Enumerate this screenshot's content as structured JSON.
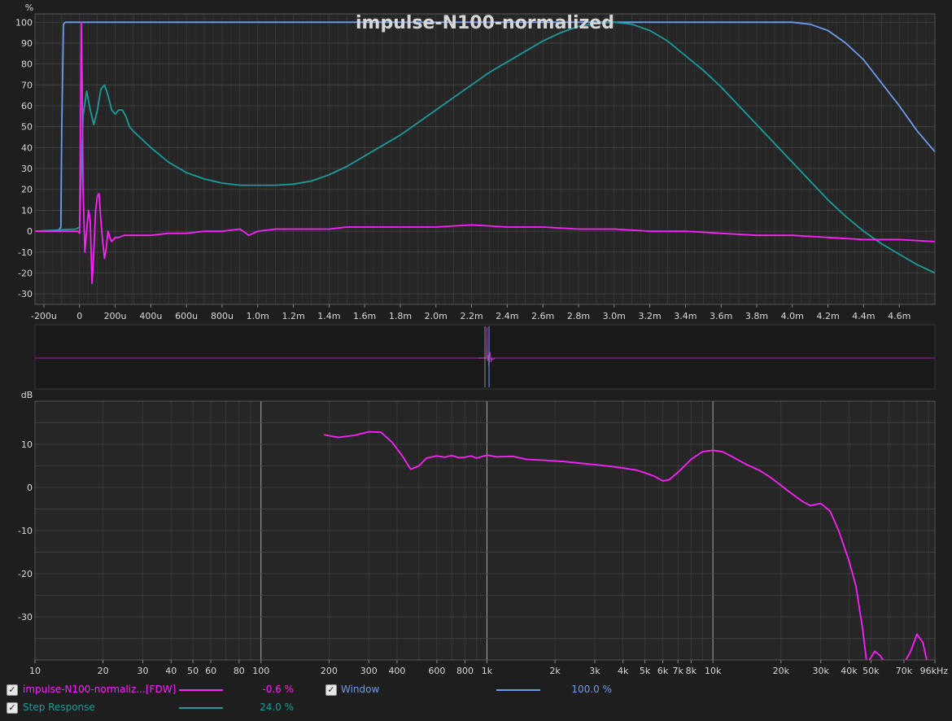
{
  "title": "impulse-N100-normalized",
  "colors": {
    "background": "#1e1e1e",
    "plot_bg": "#262626",
    "grid": "#444444",
    "impulse": "#ff20ff",
    "window": "#6d9bee",
    "step": "#1b9c9c",
    "text": "#d8d8d8"
  },
  "chart_data": [
    {
      "type": "line",
      "panel": "time-domain",
      "ylabel": "%",
      "xlim": [
        -0.00025,
        0.0048
      ],
      "ylim": [
        -35,
        104
      ],
      "x_tick_labels": [
        "-200u",
        "0",
        "200u",
        "400u",
        "600u",
        "800u",
        "1.0m",
        "1.2m",
        "1.4m",
        "1.6m",
        "1.8m",
        "2.0m",
        "2.2m",
        "2.4m",
        "2.6m",
        "2.8m",
        "3.0m",
        "3.2m",
        "3.4m",
        "3.6m",
        "3.8m",
        "4.0m",
        "4.2m",
        "4.4m",
        "4.6m"
      ],
      "y_tick_labels": [
        "100",
        "90",
        "80",
        "70",
        "60",
        "50",
        "40",
        "30",
        "20",
        "10",
        "0",
        "-10",
        "-20",
        "-30"
      ],
      "grid": true,
      "series": [
        {
          "name": "Window",
          "color": "#6d9bee",
          "x": [
            -0.00025,
            -0.00012,
            -0.000105,
            -0.0001,
            -9e-05,
            -8e-05,
            0.0039,
            0.004,
            0.0041,
            0.0042,
            0.0043,
            0.0044,
            0.0045,
            0.0046,
            0.0047,
            0.0048
          ],
          "y": [
            0,
            0,
            2,
            50,
            99,
            100,
            100,
            100,
            99,
            96,
            90,
            82,
            71,
            60,
            48,
            38
          ]
        },
        {
          "name": "Step Response",
          "color": "#1b9c9c",
          "x": [
            -0.00025,
            -2e-05,
            0.0,
            2e-05,
            4e-05,
            6e-05,
            8e-05,
            0.0001,
            0.00012,
            0.00014,
            0.00016,
            0.00018,
            0.0002,
            0.00022,
            0.00024,
            0.00026,
            0.00028,
            0.0003,
            0.0004,
            0.0005,
            0.0006,
            0.0007,
            0.0008,
            0.0009,
            0.001,
            0.0011,
            0.0012,
            0.0013,
            0.0014,
            0.0015,
            0.0016,
            0.0017,
            0.0018,
            0.0019,
            0.002,
            0.0021,
            0.0022,
            0.0023,
            0.0024,
            0.0025,
            0.0026,
            0.0027,
            0.0028,
            0.0029,
            0.003,
            0.0031,
            0.0032,
            0.0033,
            0.0034,
            0.0035,
            0.0036,
            0.0037,
            0.0038,
            0.0039,
            0.004,
            0.0041,
            0.0042,
            0.0043,
            0.0044,
            0.0045,
            0.0046,
            0.0047,
            0.0048
          ],
          "y": [
            0,
            1,
            2,
            55,
            67,
            58,
            51,
            58,
            68,
            70,
            65,
            58,
            56,
            58,
            58,
            55,
            50,
            48,
            40,
            33,
            28,
            25,
            23,
            22,
            22,
            22,
            22.5,
            24,
            27,
            31,
            36,
            41,
            46,
            52,
            58,
            64,
            70,
            76,
            81,
            86,
            91,
            95,
            98,
            99.5,
            100,
            99,
            96,
            91,
            84,
            77,
            69,
            60,
            51,
            42,
            33,
            24,
            15,
            7,
            0,
            -6,
            -11,
            -16,
            -20
          ]
        },
        {
          "name": "impulse-N100-normaliz...[FDW]",
          "color": "#ff20ff",
          "x": [
            -0.00025,
            -1e-05,
            0.0,
            5e-06,
            1e-05,
            1.5e-05,
            2e-05,
            3e-05,
            4e-05,
            5e-05,
            6e-05,
            7e-05,
            8e-05,
            9e-05,
            0.0001,
            0.00011,
            0.00012,
            0.00013,
            0.00014,
            0.00015,
            0.00016,
            0.00017,
            0.00018,
            0.00019,
            0.0002,
            0.00022,
            0.00025,
            0.0003,
            0.0004,
            0.0005,
            0.0006,
            0.0007,
            0.0008,
            0.0009,
            0.00095,
            0.001,
            0.0011,
            0.0012,
            0.0013,
            0.0014,
            0.0015,
            0.0016,
            0.0017,
            0.0018,
            0.0019,
            0.002,
            0.0022,
            0.0024,
            0.0026,
            0.0028,
            0.003,
            0.0032,
            0.0034,
            0.0036,
            0.0038,
            0.004,
            0.0042,
            0.0044,
            0.0046,
            0.0048
          ],
          "y": [
            0,
            0,
            -1,
            40,
            100,
            70,
            20,
            -10,
            0,
            10,
            5,
            -25,
            -10,
            10,
            17,
            18,
            5,
            -5,
            -13,
            -8,
            0,
            -3,
            -5,
            -4,
            -3,
            -3,
            -2,
            -2,
            -2,
            -1,
            -1,
            0,
            0,
            1,
            -2,
            0,
            1,
            1,
            1,
            1,
            2,
            2,
            2,
            2,
            2,
            2,
            3,
            2,
            2,
            1,
            1,
            0,
            0,
            -1,
            -2,
            -2,
            -3,
            -4,
            -4,
            -5
          ]
        }
      ]
    },
    {
      "type": "line",
      "panel": "frequency-domain",
      "ylabel": "dB",
      "xscale": "log",
      "xlim": [
        10,
        96000
      ],
      "ylim": [
        -40,
        20
      ],
      "x_tick_labels": [
        "10",
        "20",
        "30",
        "40",
        "50",
        "60",
        "80",
        "100",
        "200",
        "300",
        "400",
        "600",
        "800",
        "1k",
        "2k",
        "3k",
        "4k",
        "5k",
        "6k",
        "7k",
        "8k",
        "10k",
        "20k",
        "30k",
        "40k",
        "50k",
        "70k",
        "96kHz"
      ],
      "y_tick_labels": [
        "10",
        "0",
        "-10",
        "-20",
        "-30"
      ],
      "grid": true,
      "series": [
        {
          "name": "impulse-N100-normaliz...[FDW]",
          "color": "#ff20ff",
          "x": [
            190,
            220,
            260,
            300,
            340,
            380,
            420,
            460,
            500,
            540,
            600,
            650,
            700,
            750,
            800,
            850,
            900,
            1000,
            1100,
            1300,
            1500,
            1800,
            2200,
            2600,
            3000,
            3500,
            4000,
            4600,
            5000,
            5500,
            6000,
            6400,
            7000,
            8000,
            9000,
            10000,
            11000,
            12000,
            14000,
            16000,
            18000,
            20000,
            22000,
            25000,
            27000,
            30000,
            33000,
            36000,
            40000,
            43000,
            46000,
            48000,
            52000,
            55000,
            60000,
            68000,
            75000,
            80000,
            85000,
            90000
          ],
          "y": [
            12.2,
            11.6,
            12.1,
            12.9,
            12.8,
            10.5,
            7.5,
            4.2,
            5.0,
            6.8,
            7.3,
            7.0,
            7.4,
            6.9,
            7.0,
            7.3,
            6.8,
            7.5,
            7.1,
            7.2,
            6.5,
            6.3,
            6.0,
            5.6,
            5.3,
            4.9,
            4.5,
            4.0,
            3.4,
            2.6,
            1.5,
            1.8,
            3.5,
            6.5,
            8.3,
            8.6,
            8.3,
            7.3,
            5.4,
            4.0,
            2.3,
            0.5,
            -1.2,
            -3.3,
            -4.2,
            -3.7,
            -5.5,
            -10,
            -17,
            -23,
            -33,
            -41,
            -38,
            -39,
            -42,
            -42,
            -38,
            -34,
            -36,
            -42
          ]
        }
      ]
    }
  ],
  "legend": {
    "items": [
      {
        "name": "impulse-N100-normaliz...[FDW]",
        "value": "-0.6 %",
        "color": "#ff20ff",
        "checked": true
      },
      {
        "name": "Window",
        "value": "100.0 %",
        "color": "#6d9bee",
        "checked": true
      },
      {
        "name": "Step Response",
        "value": "24.0 %",
        "color": "#1b9c9c",
        "checked": true
      }
    ]
  }
}
